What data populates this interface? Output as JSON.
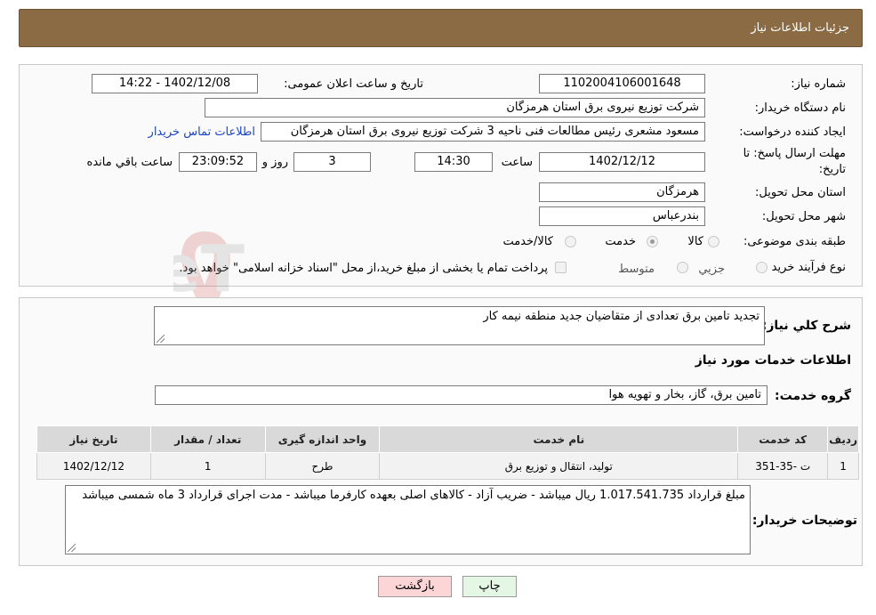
{
  "header": {
    "title": "جزئیات اطلاعات نیاز"
  },
  "details": {
    "need_number": {
      "label": "شماره نیاز:",
      "value": "1102004106001648"
    },
    "announce_datetime": {
      "label": "تاریخ و ساعت اعلان عمومی:",
      "value": "1402/12/08 - 14:22"
    },
    "buyer_org": {
      "label": "نام دستگاه خریدار:",
      "value": "شرکت توزیع نیروی برق استان هرمزگان"
    },
    "requester": {
      "label": "ایجاد کننده درخواست:",
      "value": "مسعود مشعری رئیس مطالعات فنی ناحیه 3 شرکت توزیع نیروی برق استان هرمزگان",
      "contact_link": "اطلاعات تماس خریدار"
    },
    "deadline": {
      "label_line1": "مهلت ارسال پاسخ: تا",
      "label_line2": "تاریخ:",
      "date": "1402/12/12",
      "time_label": "ساعت",
      "time": "14:30",
      "days": "3",
      "days_label": "روز و",
      "remaining": "23:09:52",
      "remaining_label": "ساعت باقي مانده"
    },
    "delivery_province": {
      "label": "استان محل تحویل:",
      "value": "هرمزگان"
    },
    "delivery_city": {
      "label": "شهر محل تحویل:",
      "value": "بندرعباس"
    },
    "category": {
      "label": "طبقه بندی موضوعی:",
      "options": [
        {
          "label": "کالا",
          "checked": false
        },
        {
          "label": "خدمت",
          "checked": true
        },
        {
          "label": "کالا/خدمت",
          "checked": false
        }
      ]
    },
    "purchase_type": {
      "label": "نوع فرآیند خرید :",
      "options": [
        {
          "label": "جزیي",
          "checked": false
        },
        {
          "label": "متوسط",
          "checked": false
        }
      ],
      "checkbox_text": "پرداخت تمام یا بخشی از مبلغ خرید،از محل \"اسناد خزانه اسلامی\" خواهد بود."
    }
  },
  "summary": {
    "description_label": "شرح کلي نياز:",
    "description_value": "تجدید تامین برق تعدادی از متقاضیان جدید منطقه نیمه کار",
    "services_heading": "اطلاعات خدمات مورد نیاز",
    "service_group_label": "گروه خدمت:",
    "service_group_value": "تامین برق، گاز، بخار و تهویه هوا"
  },
  "table": {
    "headers": [
      "ردیف",
      "کد خدمت",
      "نام خدمت",
      "واحد اندازه گیری",
      "تعداد / مقدار",
      "تاریخ نیاز"
    ],
    "rows": [
      [
        "1",
        "ت -35-351",
        "تولید، انتقال و توزیع برق",
        "طرح",
        "1",
        "1402/12/12"
      ]
    ]
  },
  "buyer_notes": {
    "label": "توضیحات خریدار:",
    "value": "مبلغ قرارداد 1.017.541.735 ریال میباشد - ضریب آزاد - کالاهای اصلی بعهده کارفرما میباشد - مدت اجرای قرارداد 3 ماه شمسی میباشد"
  },
  "buttons": {
    "back": "بازگشت",
    "print": "چاپ"
  },
  "watermark": {
    "text": "AriaTender.neT"
  }
}
